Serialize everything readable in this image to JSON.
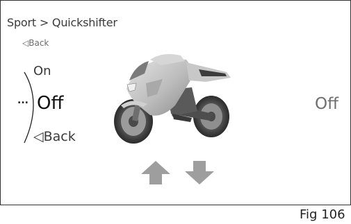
{
  "header": {
    "breadcrumb": "Sport > Quickshifter",
    "back_small": "Back"
  },
  "menu": {
    "more": "...",
    "options": [
      "On",
      "Off"
    ],
    "selected": "Off",
    "back": "Back"
  },
  "current_value": "Off",
  "figure_label": "Fig 106"
}
